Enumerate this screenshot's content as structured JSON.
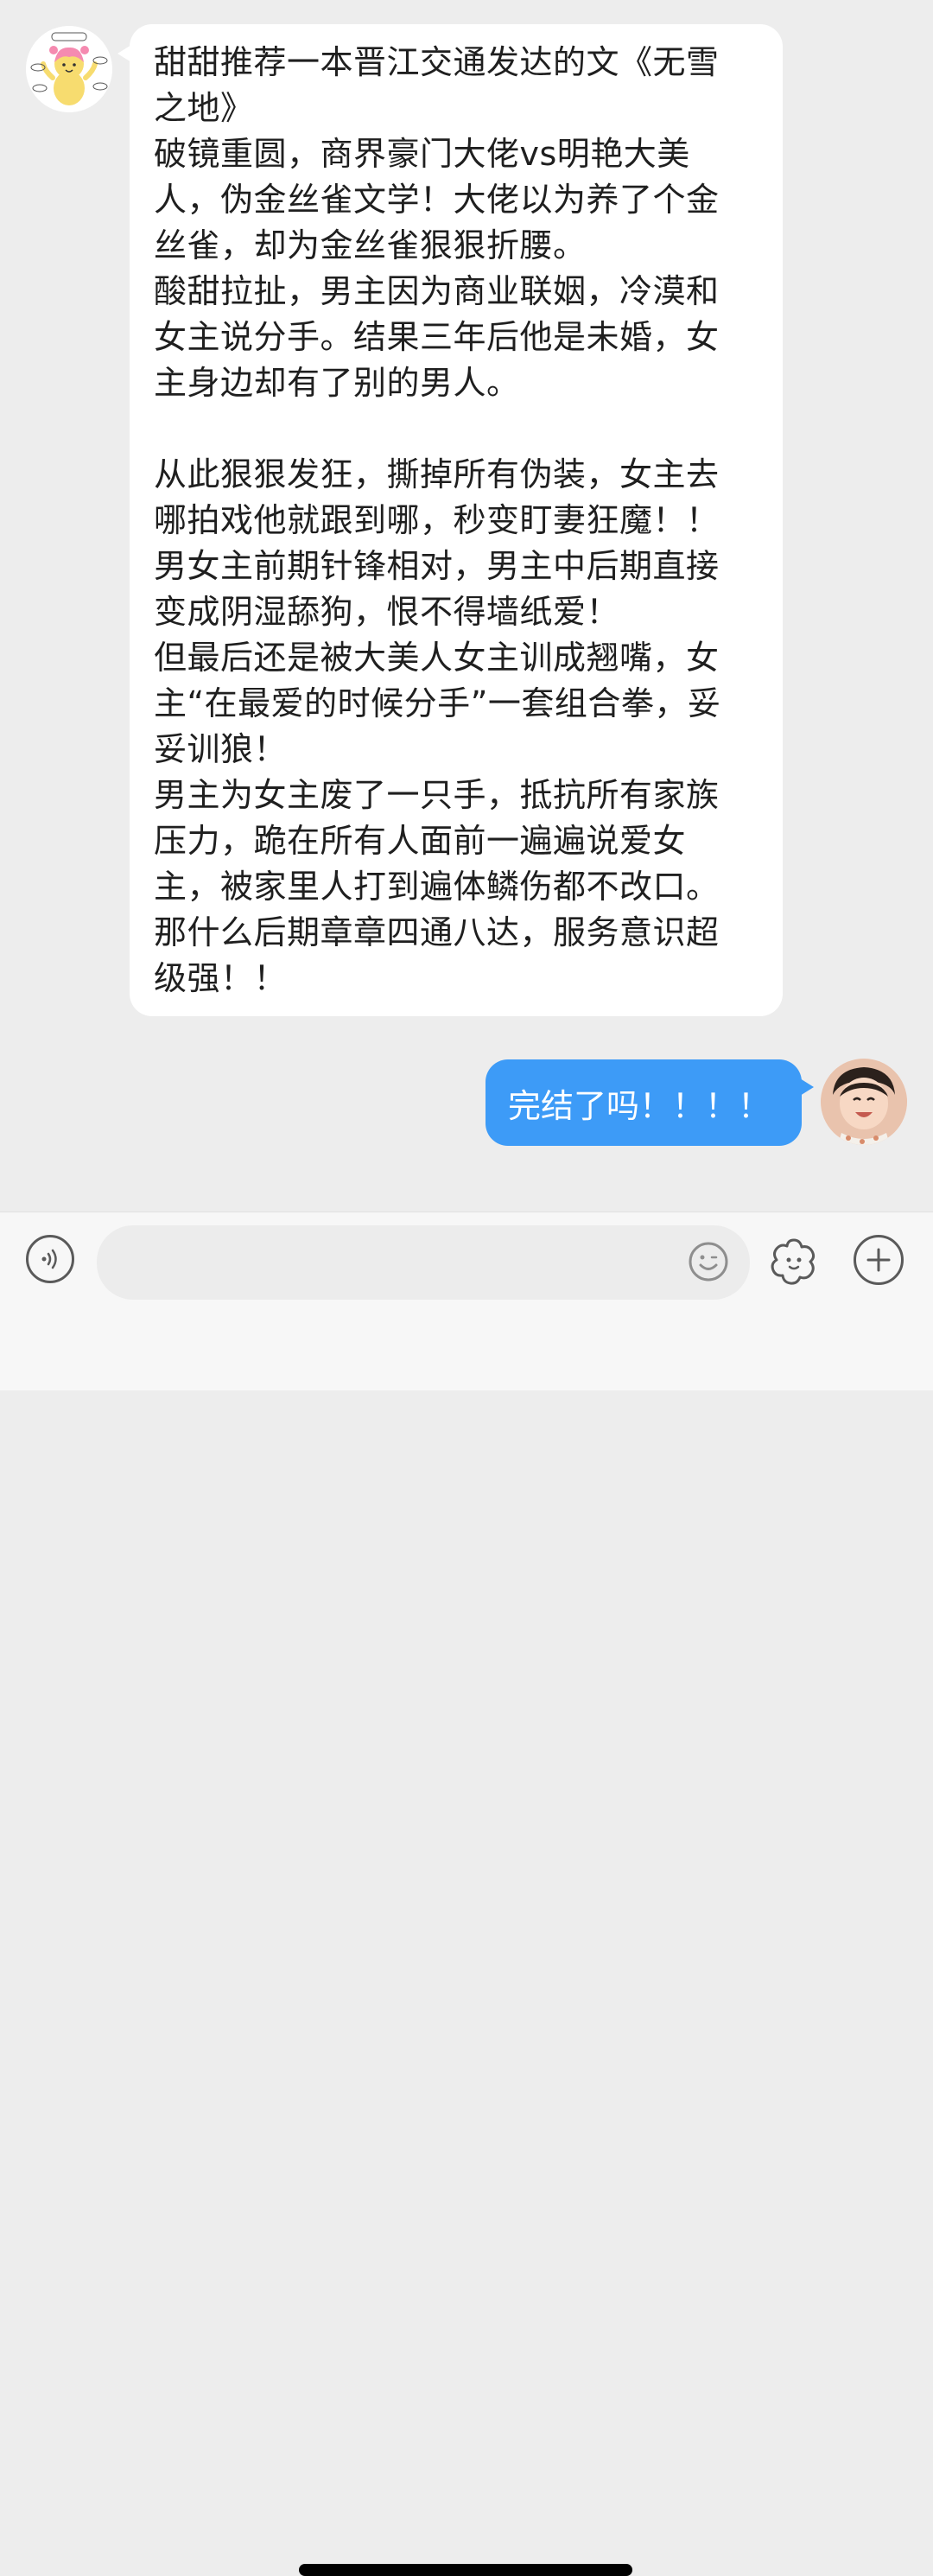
{
  "incoming_message": {
    "lines": [
      "甜甜推荐一本晋江交通发达的文《无雪",
      "之地》",
      "破镜重圆，商界豪门大佬vs明艳大美",
      "人，伪金丝雀文学！大佬以为养了个金",
      "丝雀，却为金丝雀狠狠折腰。",
      "酸甜拉扯，男主因为商业联姻，冷漠和",
      "女主说分手。结果三年后他是未婚，女",
      "主身边却有了别的男人。",
      "",
      "从此狠狠发狂，撕掉所有伪装，女主去",
      "哪拍戏他就跟到哪，秒变盯妻狂魔！！",
      "男女主前期针锋相对，男主中后期直接",
      "变成阴湿舔狗，恨不得墙纸爱！",
      "但最后还是被大美人女主训成翘嘴，女",
      "主“在最爱的时候分手”一套组合拳，妥",
      "妥训狼！",
      "男主为女主废了一只手，抵抗所有家族",
      "压力，跪在所有人面前一遍遍说爱女",
      "主，被家里人打到遍体鳞伤都不改口。",
      "那什么后期章章四通八达，服务意识超",
      "级强！！"
    ]
  },
  "outgoing_message": {
    "text": "完结了吗！！！！"
  },
  "input_bar": {
    "placeholder": ""
  },
  "colors": {
    "chat_background": "#ededed",
    "incoming_bubble": "#ffffff",
    "outgoing_bubble": "#3d9bf7",
    "input_bar": "#f7f7f7"
  },
  "icons": {
    "voice": "voice-icon",
    "emoji": "emoji-icon",
    "sticker": "sticker-icon",
    "plus": "plus-icon"
  }
}
